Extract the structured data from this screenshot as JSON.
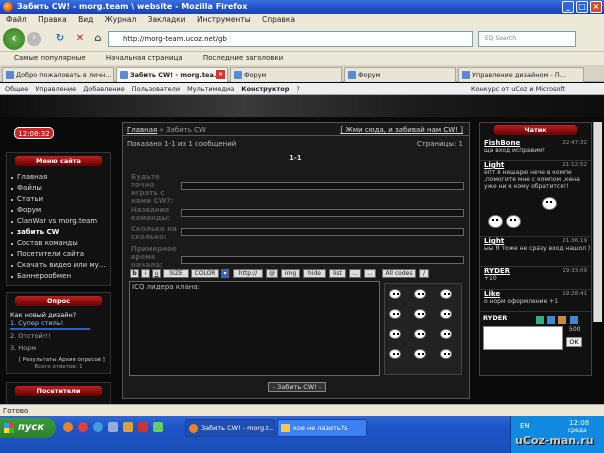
{
  "window": {
    "title": "Забить CW! - morg.team \\ website - Mozilla Firefox"
  },
  "menu": [
    "Файл",
    "Правка",
    "Вид",
    "Журнал",
    "Закладки",
    "Инструменты",
    "Справка"
  ],
  "address": {
    "url": "http://morg-team.ucoz.net/gb",
    "search_placeholder": "EQ Search"
  },
  "bookmarks": [
    "Самые популярные",
    "Начальная страница",
    "Последние заголовки"
  ],
  "tabs": [
    "Добро пожаловать в личн...",
    "Забить CW! - morg.tea...",
    "Форум",
    "Форум",
    "Управление дизайном - П..."
  ],
  "ucoz_bar": {
    "items": [
      "Общее",
      "Управление",
      "Добавление",
      "Пользователи",
      "Мультимедиа",
      "Конструктор",
      "?"
    ],
    "right": "Конкурс от uCoz и Microsoft"
  },
  "clock": "12:08:32",
  "site_menu": {
    "title": "Меню сайта",
    "items": [
      "Главная",
      "Файлы",
      "Статьи",
      "Форум",
      "ClanWar vs morg.team",
      "забить CW",
      "Состав команды",
      "Посетители сайта",
      "Скачать видео или му...",
      "Баннерообмен"
    ]
  },
  "poll": {
    "title": "Опрос",
    "question": "Как новый дизайн?",
    "options": [
      "1. Супер стиль!",
      "2. Отстой!!!",
      "3. Норм"
    ],
    "results_label": "[ Результаты",
    "archive_label": "Архив опросов ]",
    "total_label": "Всего ответов: 1"
  },
  "visitors": {
    "title": "Посетители"
  },
  "main": {
    "breadcrumb_home": "Главная",
    "breadcrumb_current": "» Забить CW",
    "cta": "[ Жми сюда, и забивай нам CW! ]",
    "shown": "Показано 1-1 из 1 сообщений",
    "pages": "Страницы: 1",
    "page_num": "1-1",
    "fields": [
      "Будьте точно играть с нами CW?:",
      "Название команды:",
      "Сколько на сколько:",
      "Примерное время начала:"
    ],
    "toolbar": [
      "b",
      "i",
      "u",
      "SIZE",
      "COLOR",
      "http://",
      "@",
      "img",
      "hide",
      "list",
      "...",
      "...",
      "All codes",
      "/"
    ],
    "textarea_label": "ICQ лидера клана:",
    "submit": "- Забить CW! -"
  },
  "chat": {
    "title": "Чатик",
    "messages": [
      {
        "name": "FishBone",
        "time": "22:47:32",
        "text": "ща вход исправим!"
      },
      {
        "name": "Light",
        "time": "21:12:52",
        "text": "епт я нешарю нече в компе ,помогите мне с компом ,кена уже ни к кому обратится!!"
      },
      {
        "name": "Light",
        "time": "21:36:19",
        "text": "ыы Я тоже не сразу вход нашол )"
      },
      {
        "name": "RYDER",
        "time": "19:33:09",
        "text": "+10"
      },
      {
        "name": "Like",
        "time": "19:28:41",
        "text": "о норм оформление +1"
      }
    ],
    "user": "RYDER",
    "counter": "500",
    "ok": "OK"
  },
  "status": "Готово",
  "taskbar": {
    "start": "пуск",
    "tasks": [
      "Забить CW! - morg.t...",
      "кое не лазить?s"
    ],
    "lang": "EN",
    "time": "12:08",
    "day": "среда"
  },
  "watermark": "uCoz-man.ru"
}
